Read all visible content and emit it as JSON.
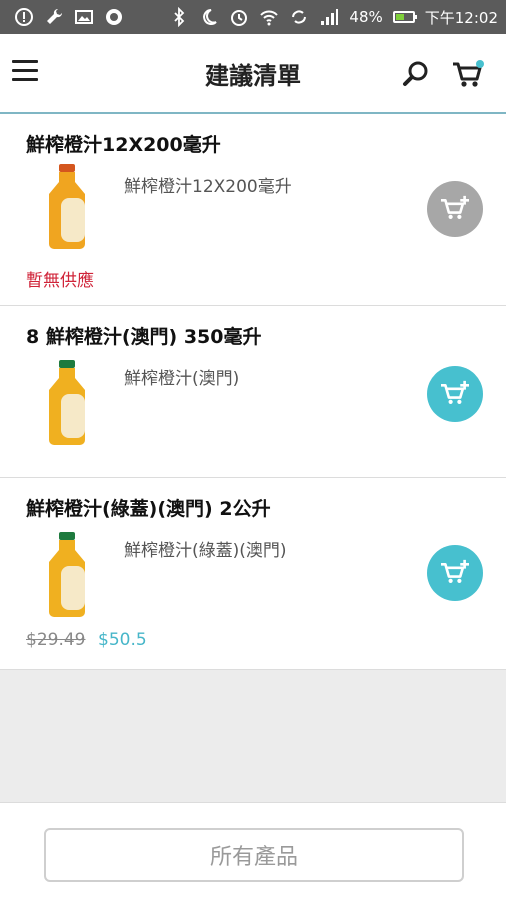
{
  "status_bar": {
    "battery_percent": "48%",
    "time": "下午12:02",
    "battery_level": 0.48
  },
  "header": {
    "title": "建議清單",
    "menu_icon": "hamburger-menu-icon",
    "search_icon": "search-icon",
    "cart_icon": "cart-icon"
  },
  "items": [
    {
      "title": "鮮榨橙汁12X200毫升",
      "description": "鮮榨橙汁12X200毫升",
      "availability": "暫無供應",
      "add_button_state": "disabled"
    },
    {
      "title": "8 鮮榨橙汁(澳門) 350毫升",
      "description": "鮮榨橙汁(澳門)",
      "add_button_state": "enabled"
    },
    {
      "title": "鮮榨橙汁(綠蓋)(澳門) 2公升",
      "description": "鮮榨橙汁(綠蓋)(澳門)",
      "old_price": "$29.49",
      "price": "$50.5",
      "add_button_state": "enabled"
    }
  ],
  "footer": {
    "all_products_label": "所有產品"
  },
  "colors": {
    "accent": "#47c0cf",
    "unavailable_text": "#d0253a",
    "disabled_button": "#a7a7a7"
  }
}
